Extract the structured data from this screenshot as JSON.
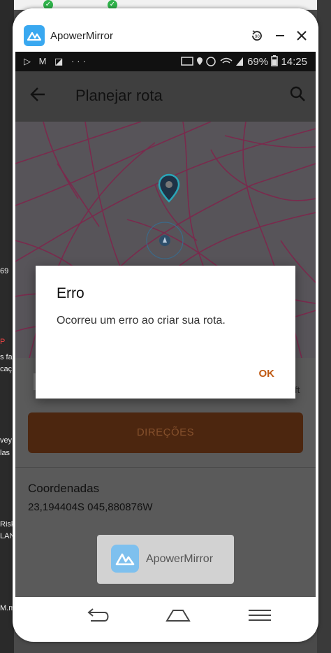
{
  "desktop": {
    "fragments": [
      "69",
      "P",
      "s fa",
      "caç",
      "vey",
      "las",
      "Risk",
      "LAN",
      "M.m"
    ]
  },
  "window": {
    "title": "ApowerMirror",
    "controls": [
      "rotate",
      "minimize",
      "close"
    ]
  },
  "statusbar": {
    "left_icons": "▷ M ◪ ···",
    "battery": "69%",
    "time": "14:25"
  },
  "appbar": {
    "title": "Planejar rota"
  },
  "panel": {
    "field_suffix": "ft",
    "directions_button": "DIREÇÕES",
    "coordinates_title": "Coordenadas",
    "coordinates_value": "23,194404S 045,880876W"
  },
  "watermark": {
    "text": "ApowerMirror"
  },
  "dialog": {
    "title": "Erro",
    "message": "Ocorreu um erro ao criar sua rota.",
    "ok": "OK"
  },
  "colors": {
    "accent": "#c05a13",
    "directions_bg": "#4c260f",
    "map_bg": "#575459",
    "road": "#7a2a4d"
  }
}
